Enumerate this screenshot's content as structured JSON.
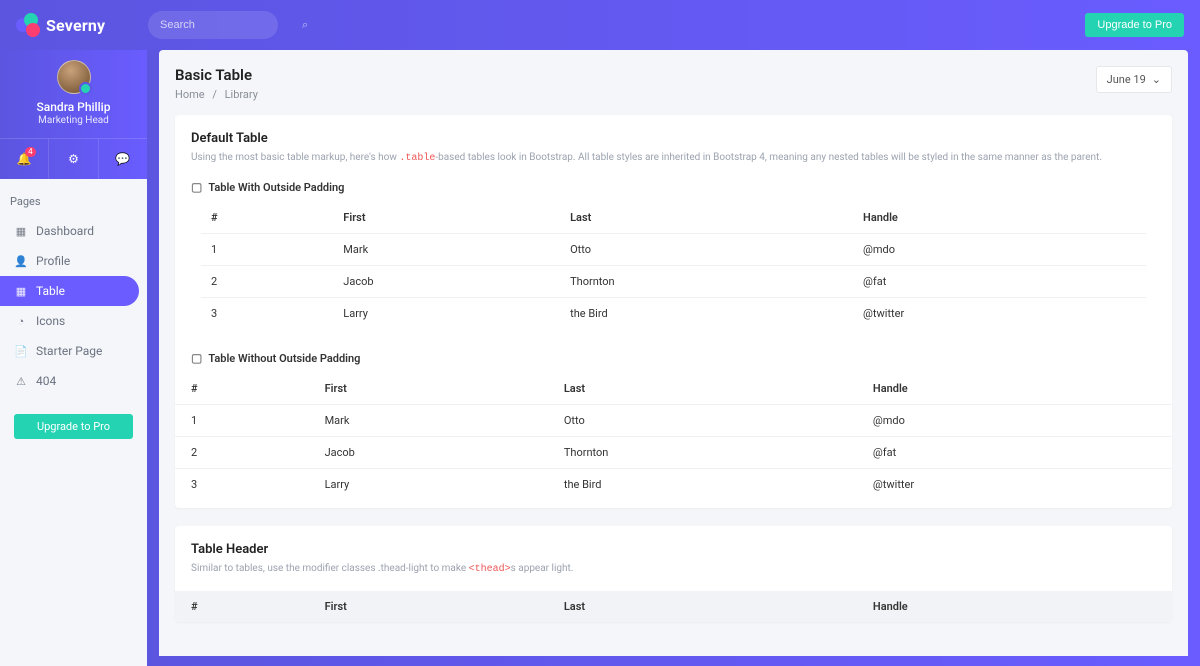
{
  "brand": "Severny",
  "search": {
    "placeholder": "Search"
  },
  "top_upgrade_label": "Upgrade to Pro",
  "profile": {
    "name": "Sandra Phillip",
    "role": "Marketing Head",
    "notification_badge": "4"
  },
  "sidebar": {
    "section_title": "Pages",
    "items": [
      {
        "label": "Dashboard",
        "icon": "▦"
      },
      {
        "label": "Profile",
        "icon": "👤"
      },
      {
        "label": "Table",
        "icon": "▦"
      },
      {
        "label": "Icons",
        "icon": "◔"
      },
      {
        "label": "Starter Page",
        "icon": "📄"
      },
      {
        "label": "404",
        "icon": "⚠"
      }
    ],
    "upgrade_label": "Upgrade to Pro"
  },
  "page": {
    "title": "Basic Table",
    "breadcrumb": {
      "home": "Home",
      "current": "Library"
    },
    "date": "June 19"
  },
  "cards": {
    "default": {
      "title": "Default Table",
      "sub_before": "Using the most basic table markup, here's how ",
      "sub_code": ".table",
      "sub_after": "-based tables look in Bootstrap. All table styles are inherited in Bootstrap 4, meaning any nested tables will be styled in the same manner as the parent.",
      "sub1": "Table With Outside Padding",
      "sub2": "Table Without Outside Padding"
    },
    "header": {
      "title": "Table Header",
      "sub_before": "Similar to tables, use the modifier classes .thead-light to make ",
      "sub_code": "<thead>",
      "sub_after": "s appear light."
    }
  },
  "table": {
    "columns": [
      "#",
      "First",
      "Last",
      "Handle"
    ],
    "rows": [
      {
        "n": "1",
        "first": "Mark",
        "last": "Otto",
        "handle": "@mdo"
      },
      {
        "n": "2",
        "first": "Jacob",
        "last": "Thornton",
        "handle": "@fat"
      },
      {
        "n": "3",
        "first": "Larry",
        "last": "the Bird",
        "handle": "@twitter"
      }
    ]
  }
}
